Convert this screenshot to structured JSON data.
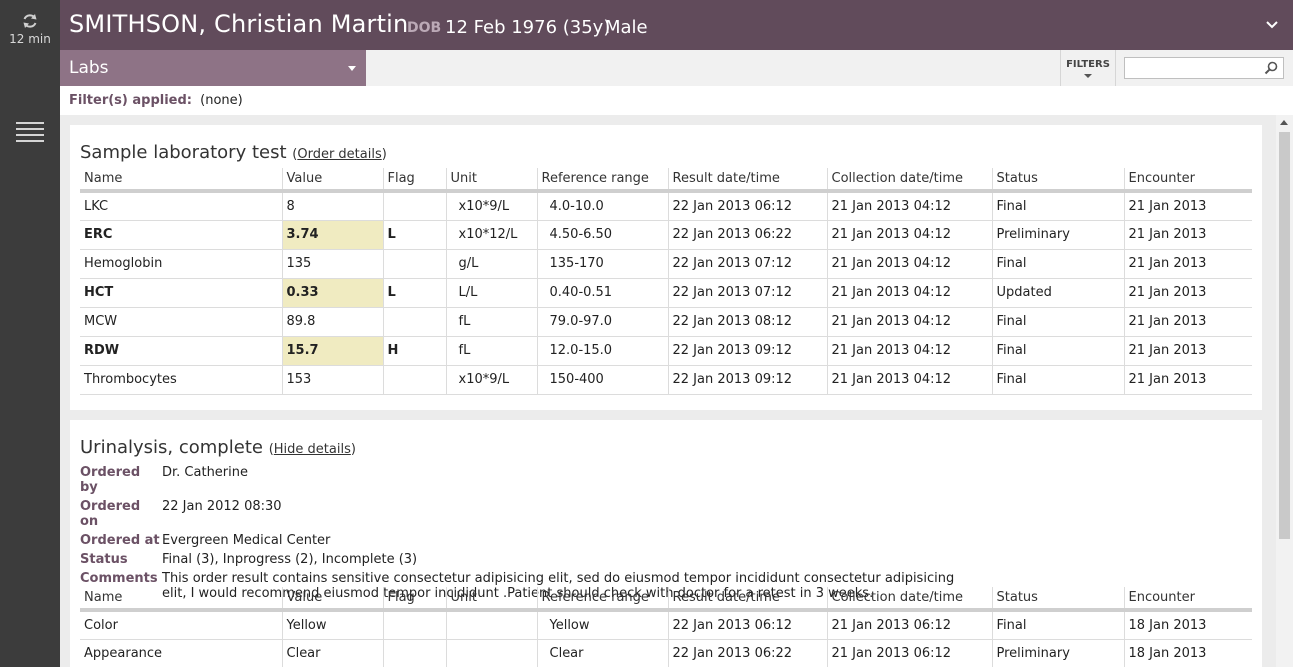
{
  "rail": {
    "refresh_time": "12 min"
  },
  "header": {
    "patient_name": "SMITHSON, Christian Martin",
    "dob_label": "DOB",
    "dob_value": "12 Feb 1976 (35y)",
    "sex": "Male"
  },
  "toolbar": {
    "section": "Labs",
    "filters_label": "FILTERS",
    "search_value": ""
  },
  "filter_line": {
    "label": "Filter(s) applied:",
    "value": "(none)"
  },
  "columns": [
    "Name",
    "Value",
    "Flag",
    "Unit",
    "Reference range",
    "Result date/time",
    "Collection date/time",
    "Status",
    "Encounter"
  ],
  "card1": {
    "title": "Sample laboratory test",
    "link": "Order details",
    "rows": [
      {
        "name": "LKC",
        "value": "8",
        "flag": "",
        "unit": "x10*9/L",
        "range": "4.0-10.0",
        "result": "22 Jan 2013  06:12",
        "collection": "21 Jan 2013  04:12",
        "status": "Final",
        "encounter": "21 Jan 2013"
      },
      {
        "name": "ERC",
        "value": "3.74",
        "flag": "L",
        "unit": "x10*12/L",
        "range": "4.50-6.50",
        "result": "22 Jan 2013  06:22",
        "collection": "21 Jan 2013  04:12",
        "status": "Preliminary",
        "encounter": "21 Jan 2013"
      },
      {
        "name": "Hemoglobin",
        "value": "135",
        "flag": "",
        "unit": "g/L",
        "range": "135-170",
        "result": "22 Jan 2013  07:12",
        "collection": "21 Jan 2013  04:12",
        "status": "Final",
        "encounter": "21 Jan 2013"
      },
      {
        "name": "HCT",
        "value": "0.33",
        "flag": "L",
        "unit": "L/L",
        "range": "0.40-0.51",
        "result": "22 Jan 2013  07:12",
        "collection": "21 Jan 2013  04:12",
        "status": "Updated",
        "encounter": "21 Jan 2013"
      },
      {
        "name": "MCW",
        "value": "89.8",
        "flag": "",
        "unit": "fL",
        "range": "79.0-97.0",
        "result": "22 Jan 2013  08:12",
        "collection": "21 Jan 2013  04:12",
        "status": "Final",
        "encounter": "21 Jan 2013"
      },
      {
        "name": "RDW",
        "value": "15.7",
        "flag": "H",
        "unit": "fL",
        "range": "12.0-15.0",
        "result": "22 Jan 2013  09:12",
        "collection": "21 Jan 2013  04:12",
        "status": "Final",
        "encounter": "21 Jan 2013"
      },
      {
        "name": "Thrombocytes",
        "value": "153",
        "flag": "",
        "unit": "x10*9/L",
        "range": "150-400",
        "result": "22 Jan 2013  09:12",
        "collection": "21 Jan 2013  04:12",
        "status": "Final",
        "encounter": "21 Jan 2013"
      }
    ]
  },
  "card2": {
    "title": "Urinalysis, complete",
    "link": "Hide details",
    "meta": [
      {
        "k": "Ordered by",
        "v": "Dr. Catherine"
      },
      {
        "k": "Ordered on",
        "v": "22 Jan 2012  08:30"
      },
      {
        "k": "Ordered at",
        "v": "Evergreen Medical Center"
      },
      {
        "k": "Status",
        "v": "Final (3), Inprogress (2),  Incomplete (3)"
      },
      {
        "k": "Comments",
        "v": "This order result contains sensitive consectetur adipisicing elit, sed do eiusmod tempor incididunt consectetur adipisicing elit, I would recommend eiusmod tempor incididunt .Patient should check with doctor for a retest in 3 weeks."
      }
    ],
    "rows": [
      {
        "name": "Color",
        "value": "Yellow",
        "flag": "",
        "unit": "",
        "range": "Yellow",
        "result": "22 Jan 2013  06:12",
        "collection": "21 Jan 2013  06:12",
        "status": "Final",
        "encounter": "18 Jan 2013"
      },
      {
        "name": "Appearance",
        "value": "Clear",
        "flag": "",
        "unit": "",
        "range": "Clear",
        "result": "22 Jan 2013  06:22",
        "collection": "21 Jan 2013  06:12",
        "status": "Preliminary",
        "encounter": "18 Jan 2013"
      }
    ]
  }
}
